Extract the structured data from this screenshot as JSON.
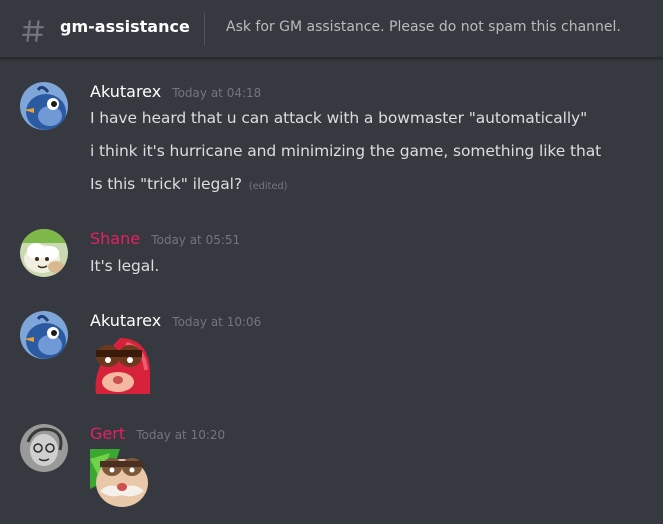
{
  "header": {
    "channel_name": "gm-assistance",
    "topic": "Ask for GM assistance. Please do not spam this channel."
  },
  "messages": [
    {
      "author": "Akutarex",
      "author_color": "#ffffff",
      "timestamp": "Today at 04:18",
      "lines": [
        "I have heard that u can attack with a bowmaster \"automatically\"",
        "i think it's hurricane and minimizing the game, something like that",
        "Is this \"trick\" ilegal?"
      ],
      "edited_label": "(edited)",
      "avatar_icon": "blue-bird-avatar-icon"
    },
    {
      "author": "Shane",
      "author_color": "#e91e63",
      "timestamp": "Today at 05:51",
      "lines": [
        "It's legal."
      ],
      "avatar_icon": "cartoon-cloud-avatar-icon"
    },
    {
      "author": "Akutarex",
      "author_color": "#ffffff",
      "timestamp": "Today at 10:06",
      "lines": [],
      "emoji_icon": "red-snail-emoji-icon",
      "avatar_icon": "blue-bird-avatar-icon"
    },
    {
      "author": "Gert",
      "author_color": "#e91e63",
      "timestamp": "Today at 10:20",
      "lines": [],
      "emoji_icon": "mustache-face-emoji-icon",
      "avatar_icon": "sketch-portrait-avatar-icon"
    }
  ],
  "colors": {
    "background": "#36393f",
    "text": "#dcddde",
    "muted": "#72767d",
    "header_text": "#ffffff",
    "pink_role": "#e91e63"
  }
}
